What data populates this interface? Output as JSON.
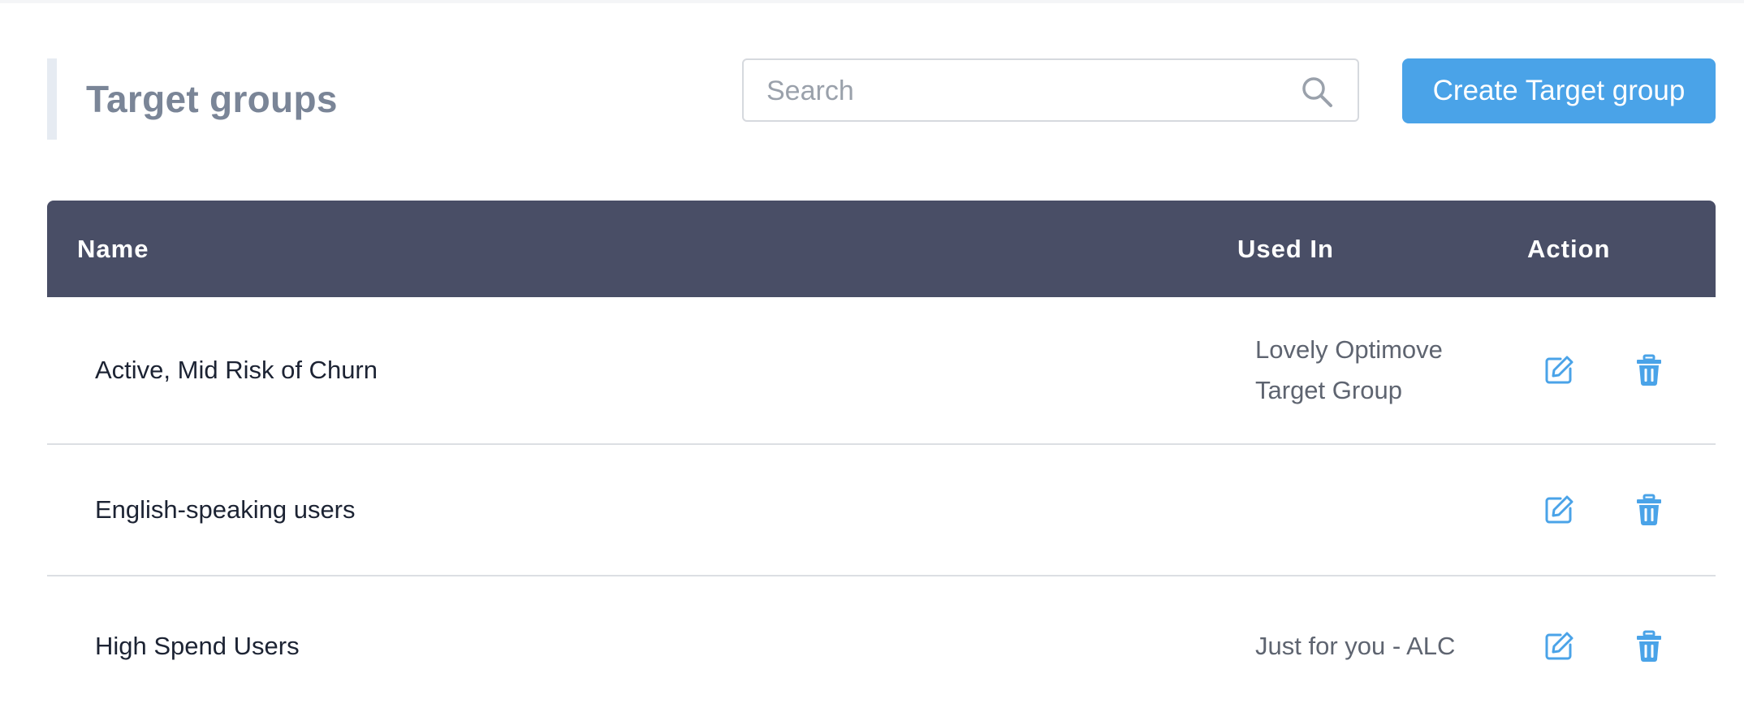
{
  "header": {
    "title": "Target groups",
    "search": {
      "placeholder": "Search",
      "value": ""
    },
    "create_button_label": "Create Target group"
  },
  "table": {
    "columns": [
      "Name",
      "Used In",
      "Action"
    ],
    "rows": [
      {
        "name": "Active, Mid Risk of Churn",
        "used_in": "Lovely Optimove Target Group"
      },
      {
        "name": "English-speaking users",
        "used_in": ""
      },
      {
        "name": "High Spend Users",
        "used_in": "Just for you - ALC"
      }
    ]
  },
  "icons": {
    "search": "search-icon",
    "edit": "edit-icon",
    "delete": "trash-icon"
  },
  "colors": {
    "accent": "#4aa3e8",
    "table_header_bg": "#494e66",
    "title_text": "#7a8597"
  }
}
